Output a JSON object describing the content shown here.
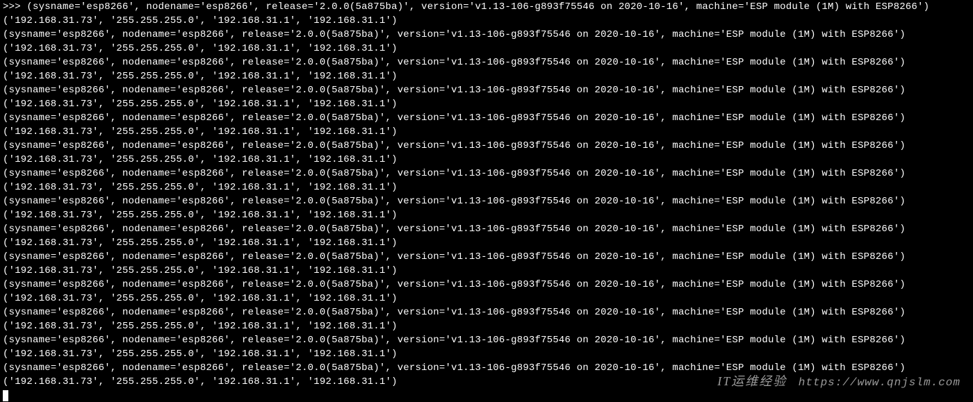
{
  "prompt": ">>> ",
  "uname_fields": {
    "sysname": "esp8266",
    "nodename": "esp8266",
    "release": "2.0.0(5a875ba)",
    "version": "v1.13-106-g893f75546 on 2020-10-16",
    "machine": "ESP module (1M) with ESP8266"
  },
  "network_tuple": [
    "192.168.31.73",
    "255.255.255.0",
    "192.168.31.1",
    "192.168.31.1"
  ],
  "repeat_count": 14,
  "watermark": {
    "label": "IT运维经验",
    "url": "https://www.qnjslm.com"
  }
}
